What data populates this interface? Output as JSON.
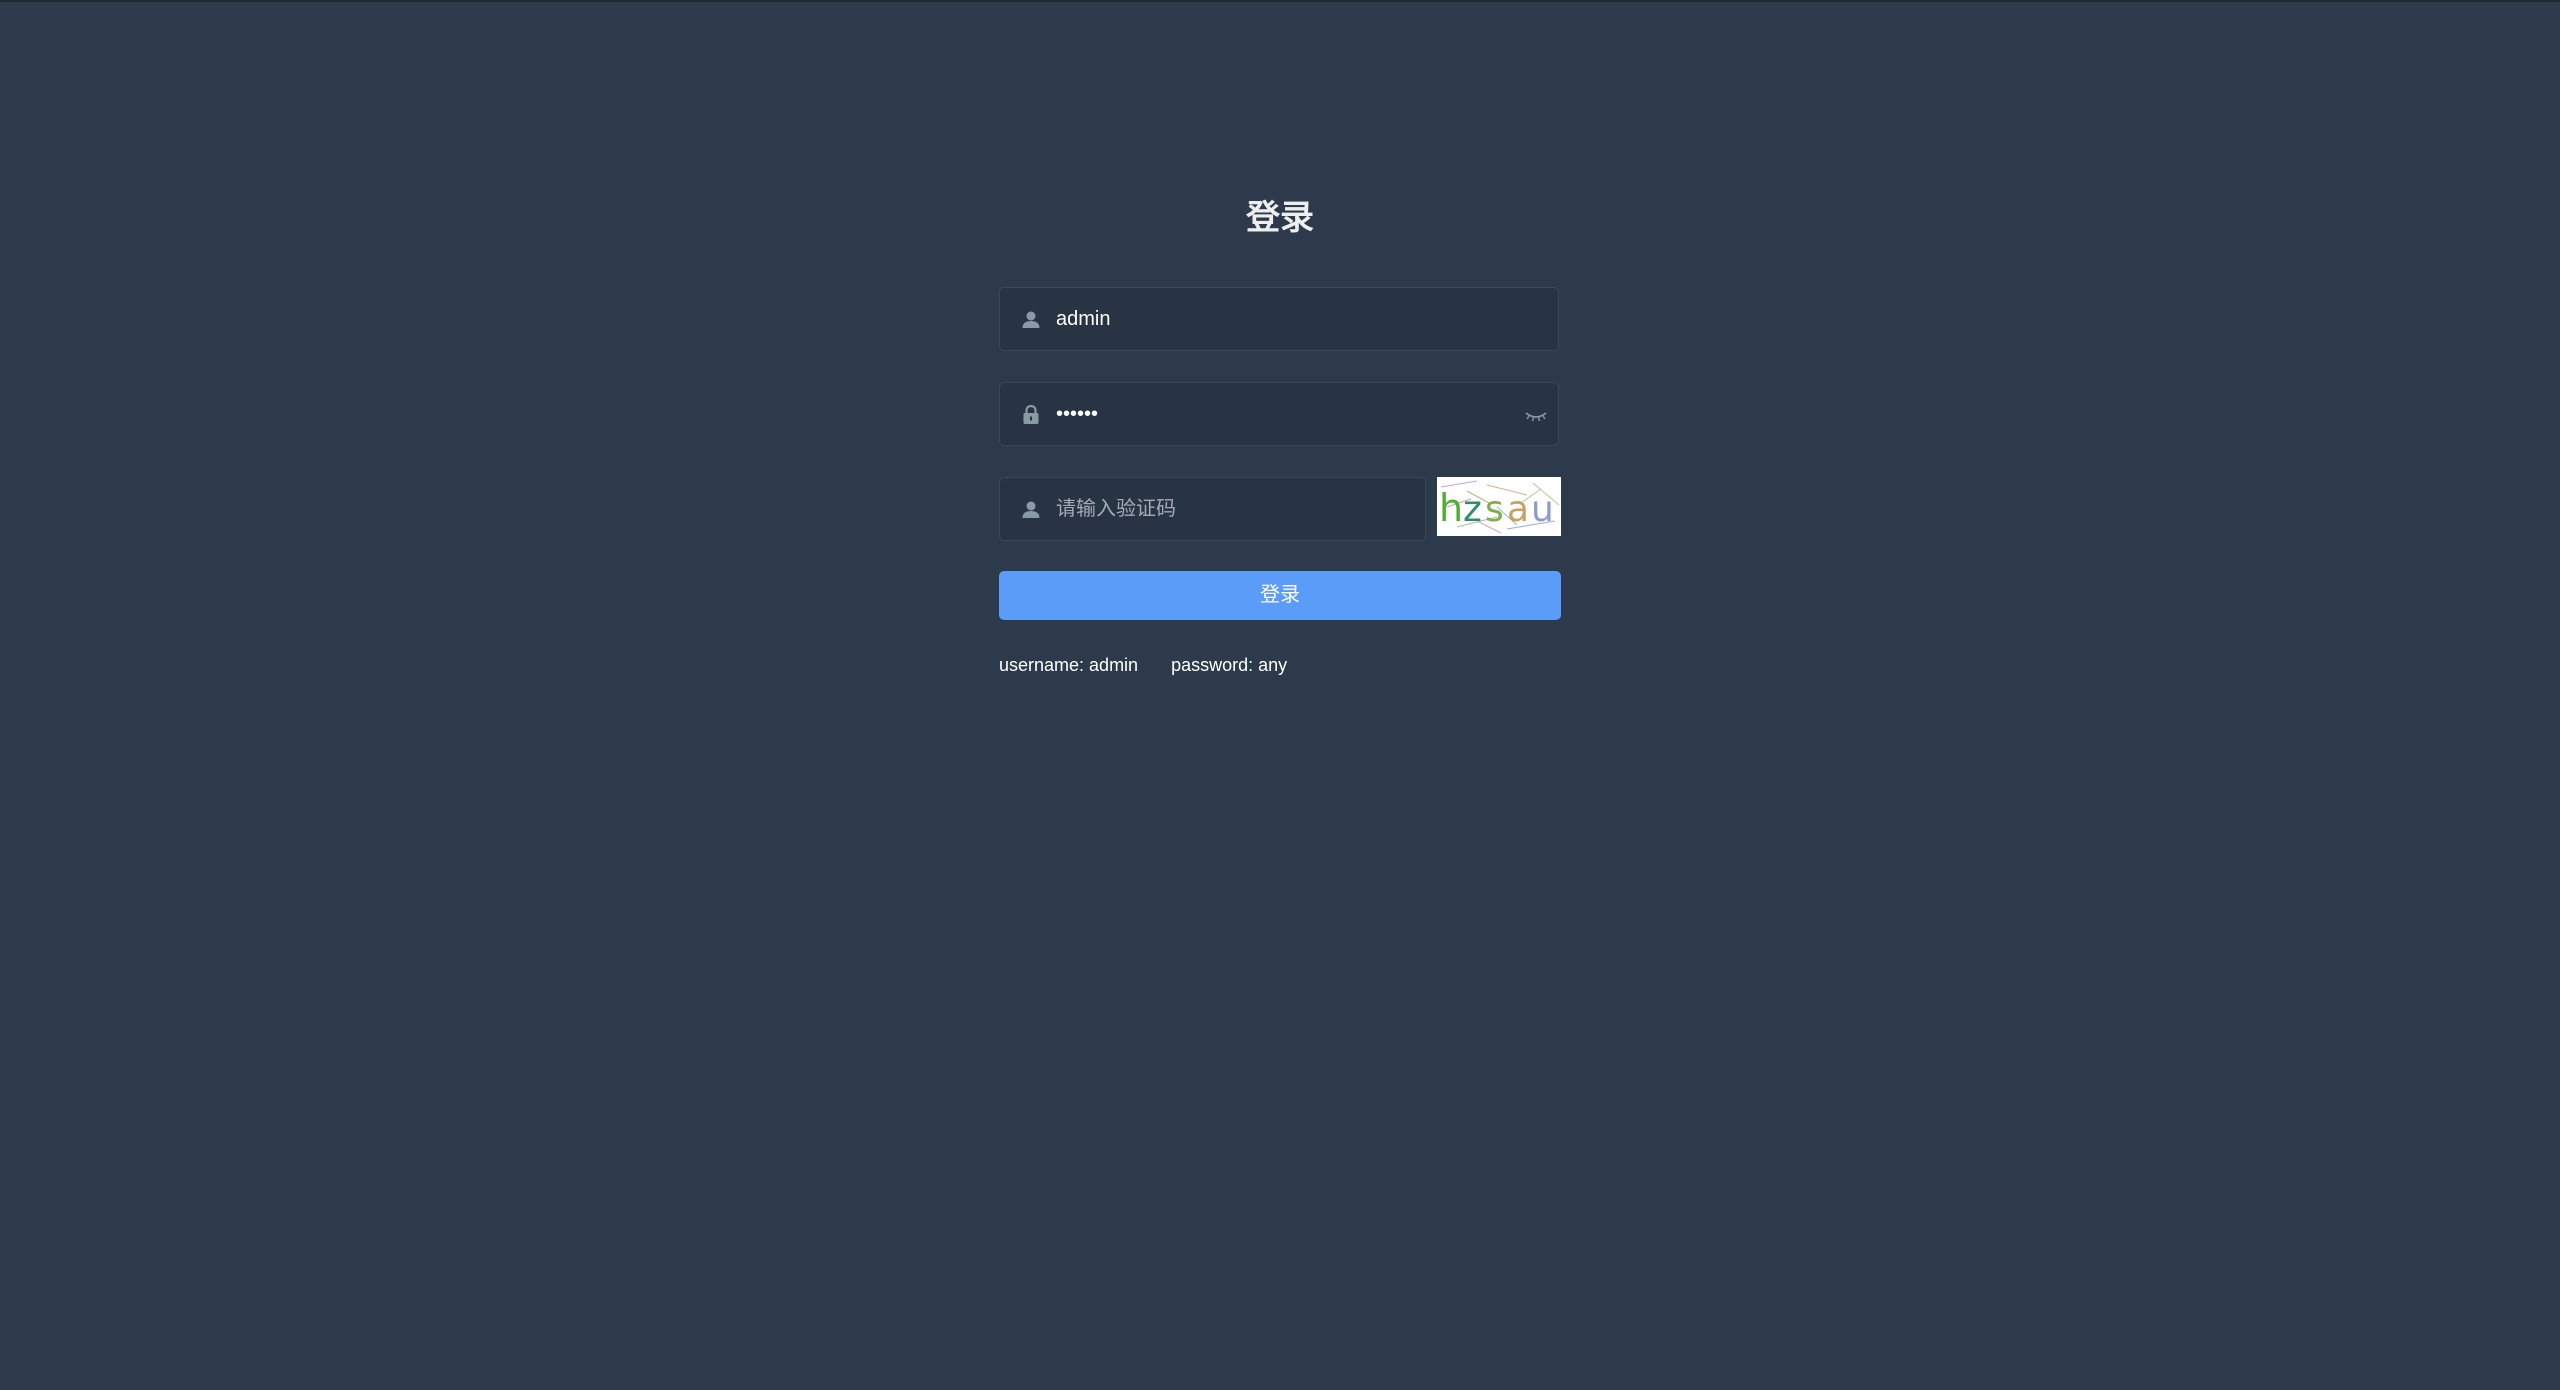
{
  "title": "登录",
  "username": {
    "icon": "user-icon",
    "value": "admin"
  },
  "password": {
    "icon": "lock-icon",
    "masked_value": "••••••",
    "toggle_icon": "eye-closed-icon"
  },
  "captcha": {
    "icon": "user-icon",
    "placeholder": "请输入验证码",
    "image_text": "hzsau"
  },
  "login_button": "登录",
  "tips": {
    "username": "username: admin",
    "password": "password: any"
  },
  "colors": {
    "background": "#2d3a4b",
    "input_background": "#283443",
    "button": "#5a9cf8"
  }
}
